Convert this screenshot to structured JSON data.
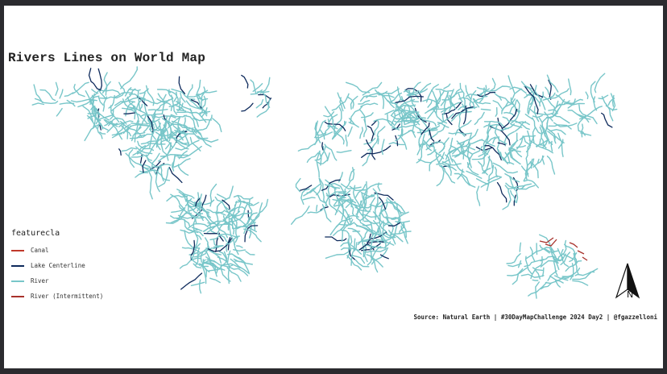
{
  "title": "Rivers Lines on World Map",
  "legend": {
    "title": "featurecla",
    "items": [
      {
        "label": "Canal",
        "color": "#c0392b"
      },
      {
        "label": "Lake Centerline",
        "color": "#0e2a5c"
      },
      {
        "label": "River",
        "color": "#78c6c9"
      },
      {
        "label": "River (Intermittent)",
        "color": "#a8322c"
      }
    ]
  },
  "caption": "Source: Natural Earth | #30DayMapChallenge 2024 Day2 | @fgazzelloni",
  "north_arrow": {
    "label": "N",
    "icon": "north-arrow-icon"
  },
  "colors": {
    "river": "#78c6c9",
    "lake_centerline": "#0e2a5c",
    "canal": "#c0392b",
    "intermittent": "#a8322c"
  }
}
